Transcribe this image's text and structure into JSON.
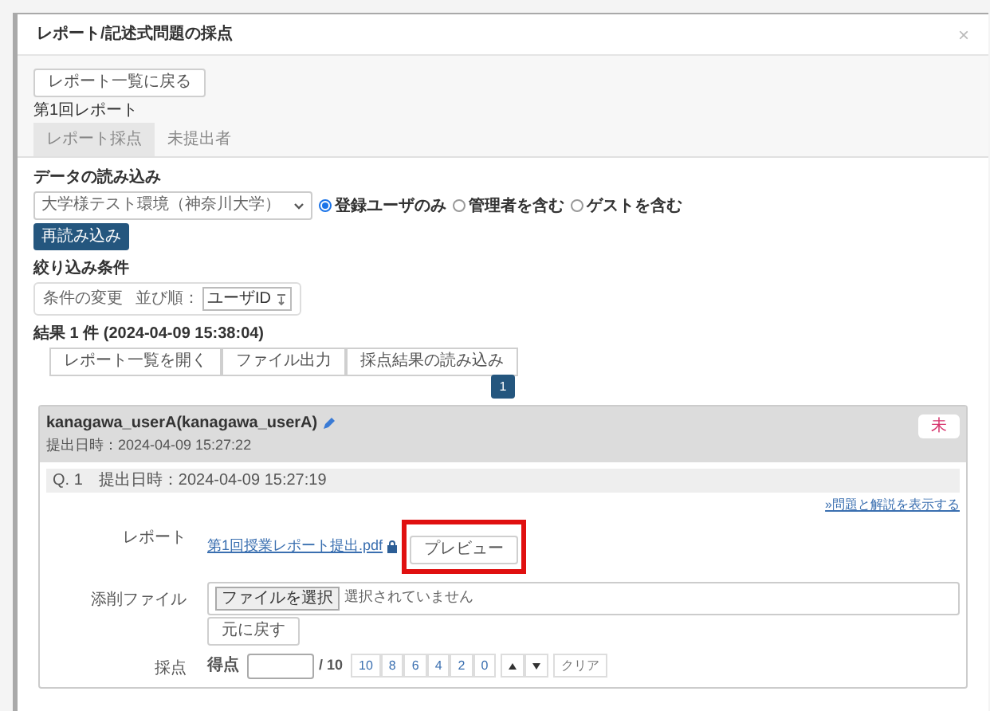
{
  "dialog": {
    "title": "レポート/記述式問題の採点",
    "close": "×"
  },
  "back_button": "レポート一覧に戻る",
  "report_title": "第1回レポート",
  "tabs": [
    {
      "label": "レポート採点",
      "selected": true
    },
    {
      "label": "未提出者",
      "selected": false
    }
  ],
  "data_load": {
    "heading": "データの読み込み",
    "select_value": "大学様テスト環境（神奈川大学）",
    "radios": [
      {
        "label": "登録ユーザのみ",
        "selected": true
      },
      {
        "label": "管理者を含む",
        "selected": false
      },
      {
        "label": "ゲストを含む",
        "selected": false
      }
    ],
    "reload_button": "再読み込み"
  },
  "filter": {
    "heading": "絞り込み条件",
    "change_label": "条件の変更",
    "sort_label": "並び順：",
    "sort_value": "ユーザID"
  },
  "results": {
    "heading": "結果 1 件 (2024-04-09 15:38:04)",
    "buttons": [
      "レポート一覧を開く",
      "ファイル出力",
      "採点結果の読み込み"
    ]
  },
  "pagination": [
    {
      "label": "1",
      "selected": true
    }
  ],
  "submission": {
    "user": "kanagawa_userA(kanagawa_userA)",
    "submitted": "提出日時：2024-04-09 15:27:22",
    "status_badge": "未",
    "question": "Q. 1　提出日時：2024-04-09 15:27:19",
    "show_answer_link": "»問題と解説を表示する",
    "report": {
      "label": "レポート",
      "file_link": "第1回授業レポート提出.pdf",
      "preview_button": "プレビュー",
      "highlighted": true
    },
    "correction": {
      "label": "添削ファイル",
      "file_button": "ファイルを選択",
      "file_status": "選択されていません",
      "revert_button": "元に戻す"
    },
    "score": {
      "label": "採点",
      "field_label": "得点",
      "max": "/ 10",
      "quick_buttons": [
        "10",
        "8",
        "6",
        "4",
        "2",
        "0"
      ],
      "clear_button": "クリア"
    }
  }
}
